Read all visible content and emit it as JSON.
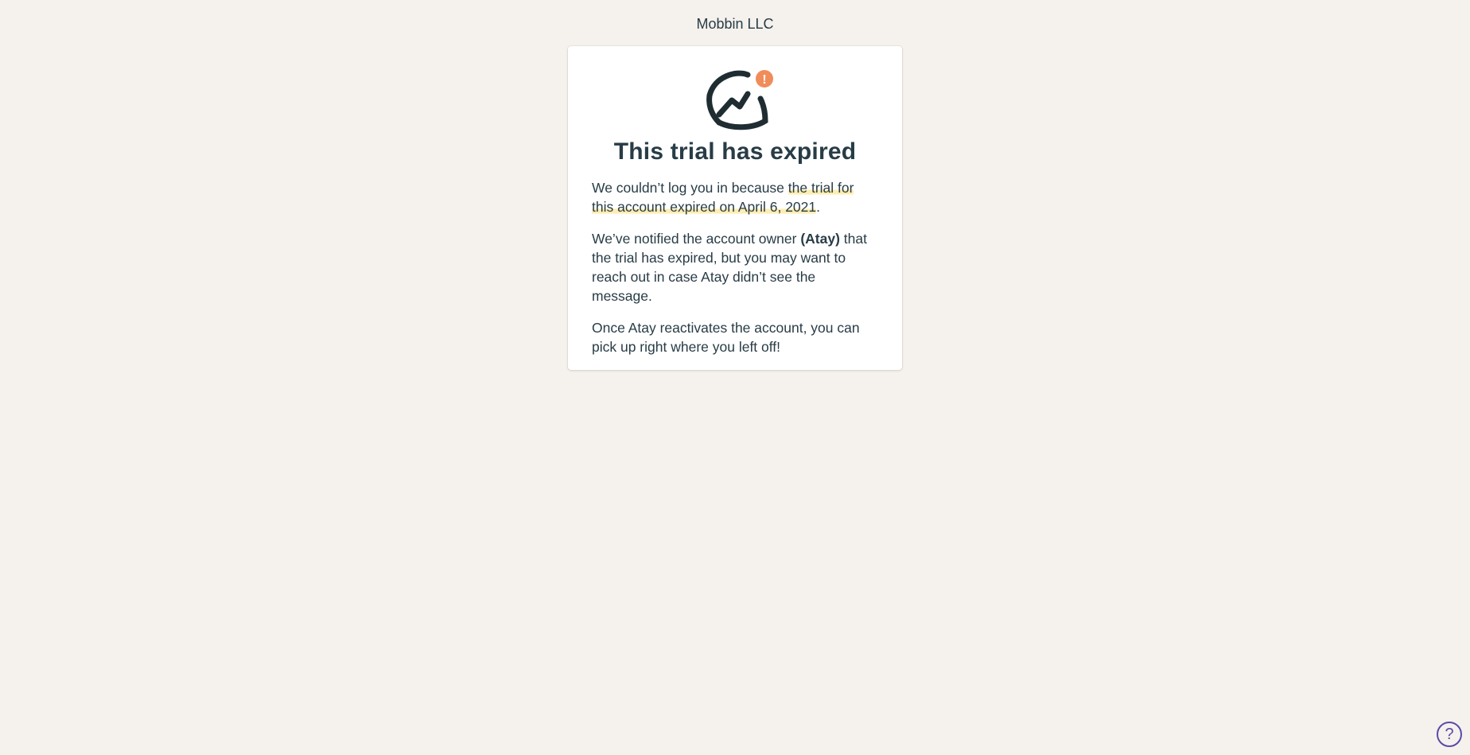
{
  "header": {
    "account_name": "Mobbin LLC"
  },
  "card": {
    "logo_icon": "basecamp-logo-icon",
    "alert_badge": "!",
    "alert_color": "#f08c5a",
    "title": "This trial has expired",
    "paragraph1": {
      "before": "We couldn’t log you in because ",
      "highlight": "the trial for this account expired on April 6, 2021",
      "after": "."
    },
    "paragraph2": {
      "before": "We’ve notified the account owner ",
      "owner": "(Atay)",
      "after": " that the trial has expired, but you may want to reach out in case Atay didn’t see the message."
    },
    "paragraph3": "Once Atay reactivates the account, you can pick up right where you left off!"
  },
  "help": {
    "icon": "help-icon",
    "label": "?"
  },
  "colors": {
    "background": "#f5f1ed",
    "text": "#283c46",
    "highlight": "#fdedb2",
    "help_accent": "#5b4aa8"
  }
}
